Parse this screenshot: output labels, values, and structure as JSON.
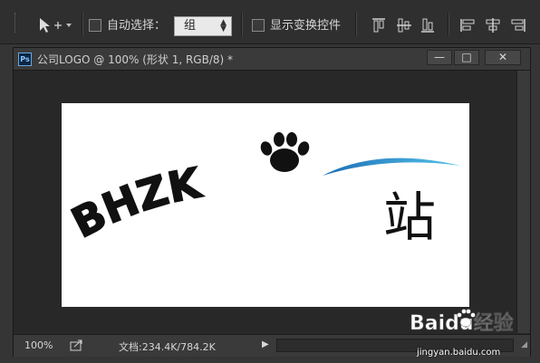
{
  "options_bar": {
    "auto_select_label": "自动选择：",
    "auto_select_target": "组",
    "show_transform_label": "显示变换控件"
  },
  "document": {
    "ps_badge": "Ps",
    "title": "公司LOGO @ 100% (形状 1, RGB/8) *",
    "window_buttons": {
      "minimize": "—",
      "restore": "□",
      "close": "✕"
    }
  },
  "artwork": {
    "logo_text": "BHZK",
    "logo_suffix": "站",
    "colors": {
      "ink": "#111111",
      "swoosh_dark": "#1c6db5",
      "swoosh_light": "#55c3ea"
    },
    "icon": "paw-print-icon"
  },
  "status": {
    "zoom": "100%",
    "doc_info": "文档:234.4K/784.2K",
    "arrow": "▶"
  },
  "watermark": {
    "brand": "Baidu经验",
    "url": "jingyan.baidu.com"
  }
}
